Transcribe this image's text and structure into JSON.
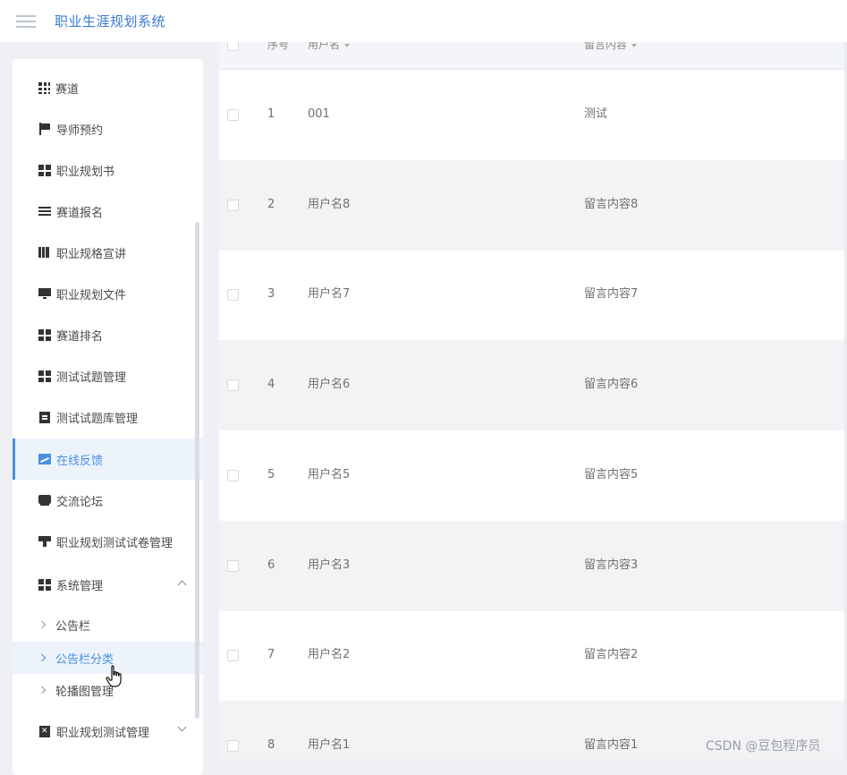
{
  "header": {
    "app_title": "职业生涯规划系统"
  },
  "sidebar": {
    "items": [
      {
        "label": "赛道",
        "icon": "grid-icon"
      },
      {
        "label": "导师预约",
        "icon": "flag-icon"
      },
      {
        "label": "职业规划书",
        "icon": "apps-icon"
      },
      {
        "label": "赛道报名",
        "icon": "list-icon"
      },
      {
        "label": "职业规格宣讲",
        "icon": "columns-icon"
      },
      {
        "label": "职业规划文件",
        "icon": "monitor-icon"
      },
      {
        "label": "赛道排名",
        "icon": "apps-icon"
      },
      {
        "label": "测试试题管理",
        "icon": "apps-icon"
      },
      {
        "label": "测试试题库管理",
        "icon": "clipboard-icon"
      },
      {
        "label": "在线反馈",
        "icon": "chart-icon",
        "active": true
      },
      {
        "label": "交流论坛",
        "icon": "chat-icon"
      },
      {
        "label": "职业规划测试试卷管理",
        "icon": "stamp-icon"
      },
      {
        "label": "系统管理",
        "icon": "apps-icon",
        "expanded": true
      }
    ],
    "sub_items": [
      {
        "label": "公告栏"
      },
      {
        "label": "公告栏分类",
        "hover": true
      },
      {
        "label": "轮播图管理"
      }
    ],
    "last_item": {
      "label": "职业规划测试管理",
      "icon": "clipboard-x-icon"
    }
  },
  "table": {
    "columns": [
      "序号",
      "用户名",
      "留言内容"
    ],
    "rows": [
      {
        "index": "1",
        "username": "001",
        "message": "测试"
      },
      {
        "index": "2",
        "username": "用户名8",
        "message": "留言内容8"
      },
      {
        "index": "3",
        "username": "用户名7",
        "message": "留言内容7"
      },
      {
        "index": "4",
        "username": "用户名6",
        "message": "留言内容6"
      },
      {
        "index": "5",
        "username": "用户名5",
        "message": "留言内容5"
      },
      {
        "index": "6",
        "username": "用户名3",
        "message": "留言内容3"
      },
      {
        "index": "7",
        "username": "用户名2",
        "message": "留言内容2"
      },
      {
        "index": "8",
        "username": "用户名1",
        "message": "留言内容1"
      }
    ]
  },
  "watermark": "CSDN @豆包程序员"
}
